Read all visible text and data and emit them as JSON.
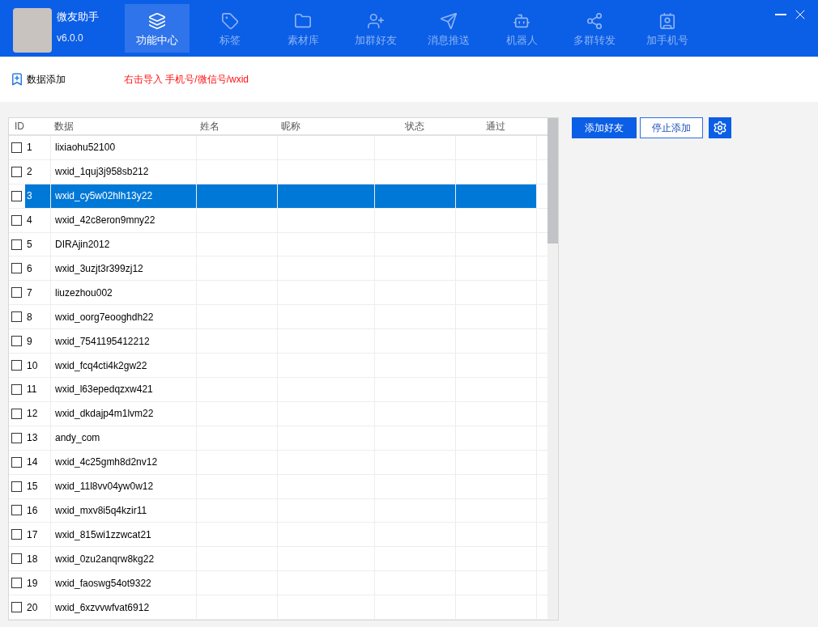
{
  "app": {
    "name": "微友助手",
    "version": "v6.0.0"
  },
  "nav_tabs": [
    {
      "label": "功能中心",
      "selected": true
    },
    {
      "label": "标签",
      "selected": false
    },
    {
      "label": "素材库",
      "selected": false
    },
    {
      "label": "加群好友",
      "selected": false
    },
    {
      "label": "消息推送",
      "selected": false
    },
    {
      "label": "机器人",
      "selected": false
    },
    {
      "label": "多群转发",
      "selected": false
    },
    {
      "label": "加手机号",
      "selected": false
    }
  ],
  "toolbar": {
    "title": "数据添加",
    "hint": "右击导入 手机号/微信号/wxid"
  },
  "table": {
    "columns": [
      "ID",
      "数据",
      "姓名",
      "昵称",
      "状态",
      "通过"
    ],
    "rows": [
      {
        "id": "1",
        "data": "lixiaohu52100",
        "checked": false,
        "selected": false
      },
      {
        "id": "2",
        "data": "wxid_1quj3j958sb212",
        "checked": false,
        "selected": false
      },
      {
        "id": "3",
        "data": "wxid_cy5w02hlh13y22",
        "checked": false,
        "selected": true
      },
      {
        "id": "4",
        "data": "wxid_42c8eron9mny22",
        "checked": false,
        "selected": false
      },
      {
        "id": "5",
        "data": "DIRAjin2012",
        "checked": false,
        "selected": false
      },
      {
        "id": "6",
        "data": "wxid_3uzjt3r399zj12",
        "checked": false,
        "selected": false
      },
      {
        "id": "7",
        "data": "liuzezhou002",
        "checked": false,
        "selected": false
      },
      {
        "id": "8",
        "data": "wxid_oorg7eooghdh22",
        "checked": false,
        "selected": false
      },
      {
        "id": "9",
        "data": "wxid_7541195412212",
        "checked": false,
        "selected": false
      },
      {
        "id": "10",
        "data": "wxid_fcq4cti4k2gw22",
        "checked": false,
        "selected": false
      },
      {
        "id": "11",
        "data": "wxid_l63epedqzxw421",
        "checked": false,
        "selected": false
      },
      {
        "id": "12",
        "data": "wxid_dkdajp4m1lvm22",
        "checked": false,
        "selected": false
      },
      {
        "id": "13",
        "data": "andy_com",
        "checked": false,
        "selected": false
      },
      {
        "id": "14",
        "data": "wxid_4c25gmh8d2nv12",
        "checked": false,
        "selected": false
      },
      {
        "id": "15",
        "data": "wxid_11l8vv04yw0w12",
        "checked": false,
        "selected": false
      },
      {
        "id": "16",
        "data": "wxid_mxv8i5q4kzir11",
        "checked": false,
        "selected": false
      },
      {
        "id": "17",
        "data": "wxid_815wi1zzwcat21",
        "checked": false,
        "selected": false
      },
      {
        "id": "18",
        "data": "wxid_0zu2anqrw8kg22",
        "checked": false,
        "selected": false
      },
      {
        "id": "19",
        "data": "wxid_faoswg54ot9322",
        "checked": false,
        "selected": false
      },
      {
        "id": "20",
        "data": "wxid_6xzvvwfvat6912",
        "checked": false,
        "selected": false
      }
    ]
  },
  "actions": {
    "primary": "添加好友",
    "secondary": "停止添加"
  }
}
